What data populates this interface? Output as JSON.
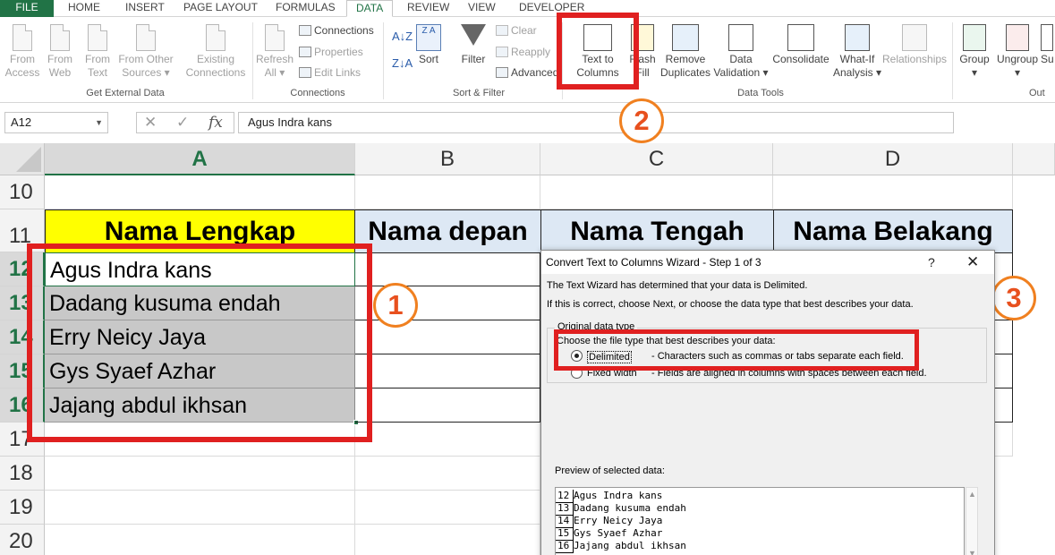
{
  "ribbon": {
    "tabs": [
      "FILE",
      "HOME",
      "INSERT",
      "PAGE LAYOUT",
      "FORMULAS",
      "DATA",
      "REVIEW",
      "VIEW",
      "DEVELOPER"
    ],
    "active_tab": "DATA",
    "get_external": {
      "from_access": [
        "From",
        "Access"
      ],
      "from_web": [
        "From",
        "Web"
      ],
      "from_text": [
        "From",
        "Text"
      ],
      "from_other": [
        "From Other",
        "Sources ▾"
      ],
      "existing": [
        "Existing",
        "Connections"
      ],
      "group_label": "Get External Data"
    },
    "connections": {
      "refresh": [
        "Refresh",
        "All ▾"
      ],
      "connections": "Connections",
      "properties": "Properties",
      "edit_links": "Edit Links",
      "group_label": "Connections"
    },
    "sort_filter": {
      "az": "A↓Z",
      "za": "Z↓A",
      "sort": "Sort",
      "filter": "Filter",
      "clear": "Clear",
      "reapply": "Reapply",
      "advanced": "Advanced",
      "group_label": "Sort & Filter"
    },
    "data_tools": {
      "text_to_columns": [
        "Text to",
        "Columns"
      ],
      "flash_fill": [
        "Flash",
        "Fill"
      ],
      "remove_duplicates": [
        "Remove",
        "Duplicates"
      ],
      "data_validation": [
        "Data",
        "Validation ▾"
      ],
      "consolidate": "Consolidate",
      "what_if": [
        "What-If",
        "Analysis ▾"
      ],
      "relationships": "Relationships",
      "group_label": "Data Tools"
    },
    "outline": {
      "group": [
        "Group",
        "▾"
      ],
      "ungroup": [
        "Ungroup",
        "▾"
      ],
      "subtotal": "Su",
      "group_label": "Out"
    }
  },
  "formula_bar": {
    "name_box": "A12",
    "x_icon": "✕",
    "check_icon": "✓",
    "fx": "fx",
    "value": "Agus Indra kans"
  },
  "sheet": {
    "columns": [
      "A",
      "B",
      "C",
      "D"
    ],
    "rows": [
      "10",
      "11",
      "12",
      "13",
      "14",
      "15",
      "16",
      "17",
      "18",
      "19",
      "20"
    ],
    "header_row": [
      "Nama Lengkap",
      "Nama depan",
      "Nama Tengah",
      "Nama Belakang"
    ],
    "data": [
      "Agus Indra kans",
      "Dadang kusuma endah",
      "Erry Neicy Jaya",
      "Gys Syaef Azhar",
      "Jajang abdul ikhsan"
    ]
  },
  "callouts": [
    "1",
    "2",
    "3"
  ],
  "dialog": {
    "title": "Convert Text to Columns Wizard - Step 1 of 3",
    "help": "?",
    "close": "✕",
    "line1": "The Text Wizard has determined that your data is Delimited.",
    "line2": "If this is correct, choose Next, or choose the data type that best describes your data.",
    "group_label": "Original data type",
    "choose_label": "Choose the file type that best describes your data:",
    "option_delimited": "Delimited",
    "desc_delimited": "- Characters such as commas or tabs separate each field.",
    "option_fixed": "Fixed width",
    "desc_fixed": "- Fields are aligned in columns with spaces between each field.",
    "preview_label": "Preview of selected data:",
    "preview_rows": [
      {
        "n": "12",
        "t": "Agus Indra kans"
      },
      {
        "n": "13",
        "t": "Dadang kusuma endah"
      },
      {
        "n": "14",
        "t": "Erry Neicy Jaya"
      },
      {
        "n": "15",
        "t": "Gys Syaef Azhar"
      },
      {
        "n": "16",
        "t": "Jajang abdul ikhsan"
      }
    ]
  },
  "colors": {
    "excel_green": "#217346",
    "highlight_yellow": "#ffff00",
    "header_blue": "#dde8f4",
    "callout_red": "#e02020",
    "callout_orange": "#f08020"
  }
}
